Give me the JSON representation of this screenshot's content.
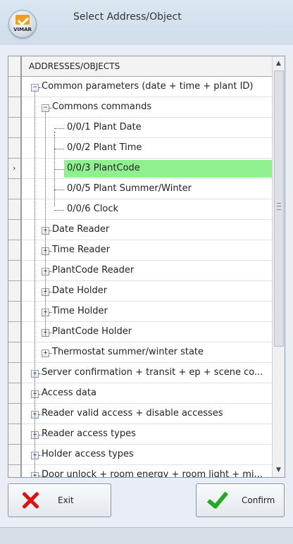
{
  "window": {
    "title": "Select Address/Object",
    "logo_text": "VIMAR"
  },
  "grid": {
    "header": "ADDRESSES/OBJECTS",
    "rows": [
      {
        "label": "Common parameters (date + time + plant ID)",
        "level": 0,
        "expander": "−"
      },
      {
        "label": "Commons commands",
        "level": 1,
        "expander": "−"
      },
      {
        "label": "0/0/1 Plant Date",
        "level": 2,
        "expander": ""
      },
      {
        "label": "0/0/2 Plant Time",
        "level": 2,
        "expander": ""
      },
      {
        "label": "0/0/3 PlantCode",
        "level": 2,
        "expander": "",
        "selected": true
      },
      {
        "label": "0/0/5 Plant Summer/Winter",
        "level": 2,
        "expander": ""
      },
      {
        "label": "0/0/6 Clock",
        "level": 2,
        "expander": ""
      },
      {
        "label": "Date Reader",
        "level": 1,
        "expander": "+"
      },
      {
        "label": "Time Reader",
        "level": 1,
        "expander": "+"
      },
      {
        "label": "PlantCode Reader",
        "level": 1,
        "expander": "+"
      },
      {
        "label": "Date Holder",
        "level": 1,
        "expander": "+"
      },
      {
        "label": "Time Holder",
        "level": 1,
        "expander": "+"
      },
      {
        "label": "PlantCode Holder",
        "level": 1,
        "expander": "+"
      },
      {
        "label": "Thermostat summer/winter state",
        "level": 1,
        "expander": "+"
      },
      {
        "label": "Server confirmation + transit + ep + scene co...",
        "level": 0,
        "expander": "+"
      },
      {
        "label": "Access data",
        "level": 0,
        "expander": "+"
      },
      {
        "label": "Reader valid access + disable accesses",
        "level": 0,
        "expander": "+"
      },
      {
        "label": "Reader access types",
        "level": 0,
        "expander": "+"
      },
      {
        "label": "Holder access types",
        "level": 0,
        "expander": "+"
      },
      {
        "label": "Door unlock + room energy + room light + mi...",
        "level": 0,
        "expander": "+"
      }
    ],
    "current_row_indicator": "›"
  },
  "buttons": {
    "exit": "Exit",
    "confirm": "Confirm"
  },
  "icons": {
    "exit": "close-x-icon",
    "confirm": "checkmark-icon"
  },
  "colors": {
    "selection": "#8ff08f",
    "exit_icon": "#dd1111",
    "confirm_icon": "#22aa22"
  }
}
